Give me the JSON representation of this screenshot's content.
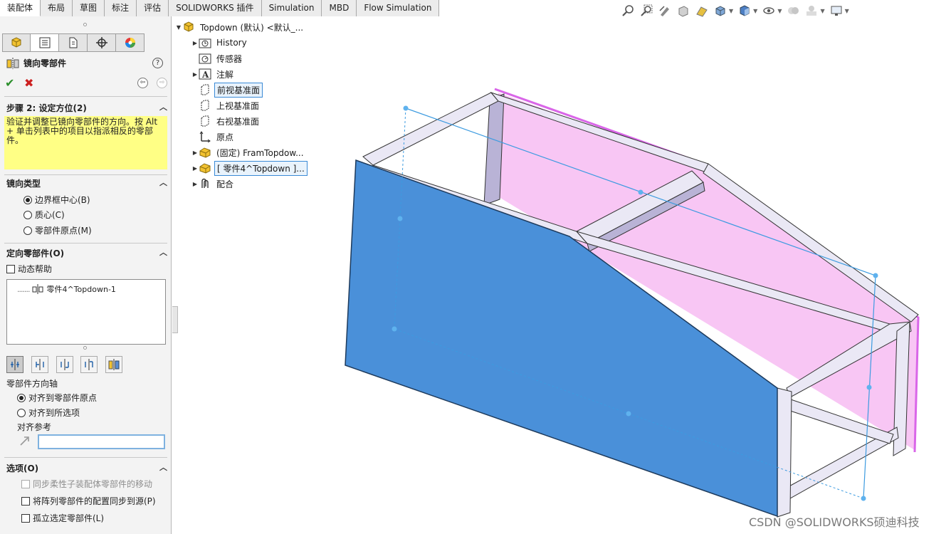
{
  "command_tabs": [
    {
      "label": "装配体",
      "active": true
    },
    {
      "label": "布局",
      "active": false
    },
    {
      "label": "草图",
      "active": false
    },
    {
      "label": "标注",
      "active": false
    },
    {
      "label": "评估",
      "active": false
    },
    {
      "label": "SOLIDWORKS 插件",
      "active": false
    },
    {
      "label": "Simulation",
      "active": false
    },
    {
      "label": "MBD",
      "active": false
    },
    {
      "label": "Flow Simulation",
      "active": false
    }
  ],
  "view_toolbar": [
    "zoom-to-fit-icon",
    "zoom-to-area-icon",
    "previous-view-icon",
    "section-view-icon",
    "dynamic-annotation-icon",
    "view-orientation-icon",
    "display-style-icon",
    "hide-show-icon",
    "edit-appearance-icon",
    "apply-scene-icon",
    "view-settings-icon"
  ],
  "property_manager": {
    "title": "镜向零部件",
    "help": "?",
    "step": {
      "header": "步骤 2: 设定方位(2)",
      "message": "验证并调整已镜向零部件的方向。按 Alt + 单击列表中的项目以指派相反的零部件。"
    },
    "mirror_type": {
      "header": "镜向类型",
      "options": [
        {
          "label": "边界框中心(B)",
          "selected": true
        },
        {
          "label": "质心(C)",
          "selected": false
        },
        {
          "label": "零部件原点(M)",
          "selected": false
        }
      ]
    },
    "orient_components": {
      "header": "定向零部件(O)",
      "dynamic_help": {
        "label": "动态帮助",
        "checked": false
      },
      "list_items": [
        "零件4^Topdown-1"
      ],
      "axis_label": "零部件方向轴",
      "axis_options": [
        {
          "label": "对齐到零部件原点",
          "selected": true
        },
        {
          "label": "对齐到所选项",
          "selected": false
        }
      ],
      "align_ref_label": "对齐参考",
      "align_ref_value": ""
    },
    "options": {
      "header": "选项(O)",
      "items": [
        {
          "label": "同步柔性子装配体零部件的移动",
          "checked": false,
          "enabled": false
        },
        {
          "label": "将阵列零部件的配置同步到源(P)",
          "checked": false,
          "enabled": true
        },
        {
          "label": "孤立选定零部件(L)",
          "checked": false,
          "enabled": true
        }
      ]
    }
  },
  "feature_tree": {
    "root": "Topdown (默认) <默认_...",
    "items": [
      {
        "label": "History",
        "icon": "history-folder-icon",
        "expandable": true,
        "selected": false
      },
      {
        "label": "传感器",
        "icon": "sensor-icon",
        "expandable": false,
        "selected": false
      },
      {
        "label": "注解",
        "icon": "annotation-icon",
        "expandable": true,
        "selected": false
      },
      {
        "label": "前视基准面",
        "icon": "plane-icon",
        "expandable": false,
        "selected": true
      },
      {
        "label": "上视基准面",
        "icon": "plane-icon",
        "expandable": false,
        "selected": false
      },
      {
        "label": "右视基准面",
        "icon": "plane-icon",
        "expandable": false,
        "selected": false
      },
      {
        "label": "原点",
        "icon": "origin-icon",
        "expandable": false,
        "selected": false
      },
      {
        "label": "(固定) FramTopdow...",
        "icon": "part-icon",
        "expandable": true,
        "selected": false
      },
      {
        "label": "[ 零件4^Topdown ]...",
        "icon": "part-icon",
        "expandable": true,
        "selected": true
      },
      {
        "label": "配合",
        "icon": "mates-icon",
        "expandable": true,
        "selected": false
      }
    ]
  },
  "colors": {
    "panel_blue": "#4a90d9",
    "pink_panel": "#f8c6f4",
    "frame_light": "#eae8f5",
    "frame_dark": "#b9b3d6",
    "preview_line": "#3c9be0",
    "highlight_edge": "#d966e8",
    "message_yellow": "#ffff85"
  },
  "watermark": "CSDN @SOLIDWORKS硕迪科技"
}
